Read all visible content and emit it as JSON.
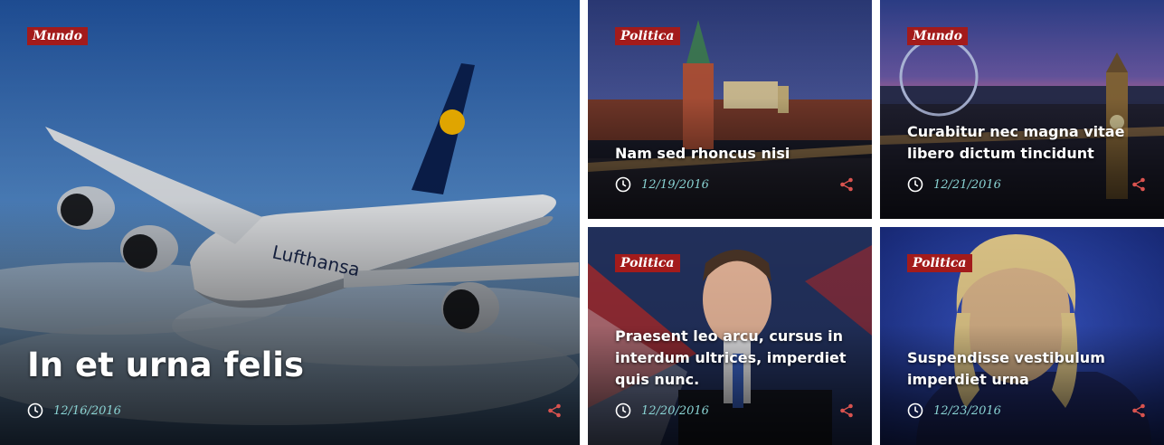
{
  "accent_color": "#a31b1b",
  "date_color": "#8ad4d4",
  "posts": [
    {
      "category": "Mundo",
      "title": "In et urna felis",
      "date": "12/16/2016"
    },
    {
      "category": "Politica",
      "title": "Nam sed rhoncus nisi",
      "date": "12/19/2016"
    },
    {
      "category": "Mundo",
      "title": "Curabitur nec magna vitae libero dictum tincidunt",
      "date": "12/21/2016"
    },
    {
      "category": "Politica",
      "title": "Praesent leo arcu, cursus in interdum ultrices, imperdiet quis nunc.",
      "date": "12/20/2016"
    },
    {
      "category": "Politica",
      "title": "Suspendisse vestibulum imperdiet urna",
      "date": "12/23/2016"
    }
  ],
  "icons": {
    "date": "clock-icon",
    "share": "share-icon"
  }
}
